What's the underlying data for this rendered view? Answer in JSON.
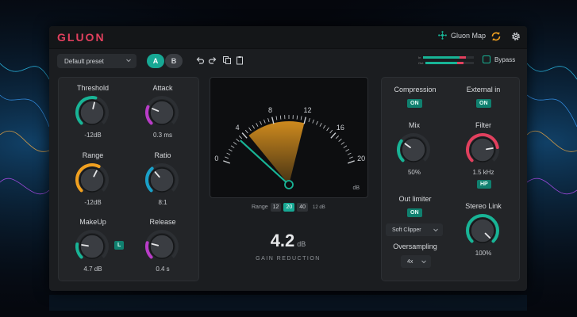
{
  "app": {
    "logo": "GLUON",
    "gluon_map_label": "Gluon Map"
  },
  "toolbar": {
    "preset": "Default preset",
    "a_label": "A",
    "b_label": "B",
    "bypass_label": "Bypass"
  },
  "meters": {
    "in_label": "In",
    "out_label": "Out",
    "in_level": 0.85,
    "out_level": 0.78
  },
  "left_knobs": [
    {
      "label": "Threshold",
      "value": "-12dB",
      "fill": 0.55,
      "color": "#18b496"
    },
    {
      "label": "Attack",
      "value": "0.3 ms",
      "fill": 0.25,
      "color": "#b93cc8"
    },
    {
      "label": "Range",
      "value": "-12dB",
      "fill": 0.6,
      "color": "#f0a020"
    },
    {
      "label": "Ratio",
      "value": "8:1",
      "fill": 0.35,
      "color": "#1aa0c8"
    },
    {
      "label": "MakeUp",
      "value": "4.7 dB",
      "fill": 0.2,
      "color": "#18b496"
    },
    {
      "label": "Release",
      "value": "0.4 s",
      "fill": 0.22,
      "color": "#b93cc8"
    }
  ],
  "makeup_badge": "L",
  "vu": {
    "scale": [
      "0",
      "4",
      "8",
      "12",
      "16",
      "20"
    ],
    "unit": "dB",
    "needle_value": 3.2,
    "fan_from": 4.4,
    "fan_to": 12
  },
  "range": {
    "label": "Range",
    "options": [
      "12",
      "20",
      "40"
    ],
    "selected": "20",
    "unit": "12 dB"
  },
  "gain_reduction": {
    "value": "4.2",
    "unit": "dB",
    "label": "GAIN REDUCTION"
  },
  "right": {
    "compression_label": "Compression",
    "compression_state": "ON",
    "external_label": "External in",
    "external_state": "ON",
    "mix": {
      "label": "Mix",
      "value": "50%",
      "fill": 0.3,
      "color": "#18b496"
    },
    "filter": {
      "label": "Filter",
      "value": "1.5 kHz",
      "fill": 0.8,
      "color": "#e2405e"
    },
    "filter_badge": "HP",
    "out_limiter_label": "Out limiter",
    "out_limiter_state": "ON",
    "clipper": "Soft Clipper",
    "oversampling_label": "Oversampling",
    "oversampling_value": "4x",
    "stereo": {
      "label": "Stereo Link",
      "value": "100%",
      "fill": 1.0,
      "color": "#18b496"
    }
  }
}
